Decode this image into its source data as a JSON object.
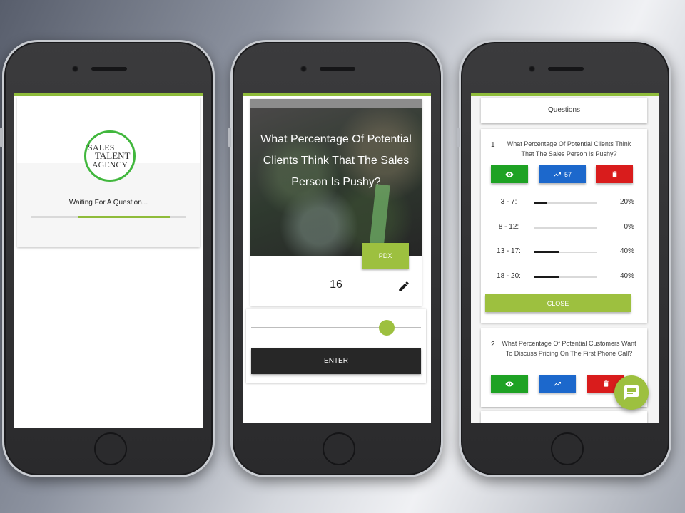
{
  "colors": {
    "accent_green": "#9dc03f",
    "logo_green": "#41b73d",
    "view_green": "#1ea224",
    "stats_blue": "#1c68cc",
    "delete_red": "#d91c1c",
    "enter_dark": "#272727"
  },
  "phone1": {
    "logo": {
      "line1": "SALES",
      "line2": "TALENT",
      "line3": "AGENCY"
    },
    "waiting_text": "Waiting For A Question...",
    "progress": {
      "start": 0.3,
      "end": 0.9
    }
  },
  "phone2": {
    "question": "What Percentage Of Potential Clients Think That The Sales Person Is Pushy?",
    "location_button": "PDX",
    "answer_value": "16",
    "edit_icon": "pencil-icon",
    "slider_value": 0.8,
    "enter_button": "ENTER"
  },
  "phone3": {
    "header": "Questions",
    "questions": [
      {
        "number": "1",
        "text": "What Percentage Of Potential Clients Think That The Sales Person Is Pushy?",
        "response_count": "57",
        "stats": [
          {
            "range": "3 - 7:",
            "percent": "20%",
            "value": 0.2
          },
          {
            "range": "8 - 12:",
            "percent": "0%",
            "value": 0.0
          },
          {
            "range": "13 - 17:",
            "percent": "40%",
            "value": 0.4
          },
          {
            "range": "18 - 20:",
            "percent": "40%",
            "value": 0.4
          }
        ],
        "close_button": "CLOSE"
      },
      {
        "number": "2",
        "text": "What Percentage Of Potential Customers Want To Discuss Pricing On The First Phone Call?"
      }
    ],
    "icons": {
      "view": "eye-icon",
      "stats": "trending-up-icon",
      "delete": "trash-icon",
      "chat": "chat-icon"
    }
  }
}
